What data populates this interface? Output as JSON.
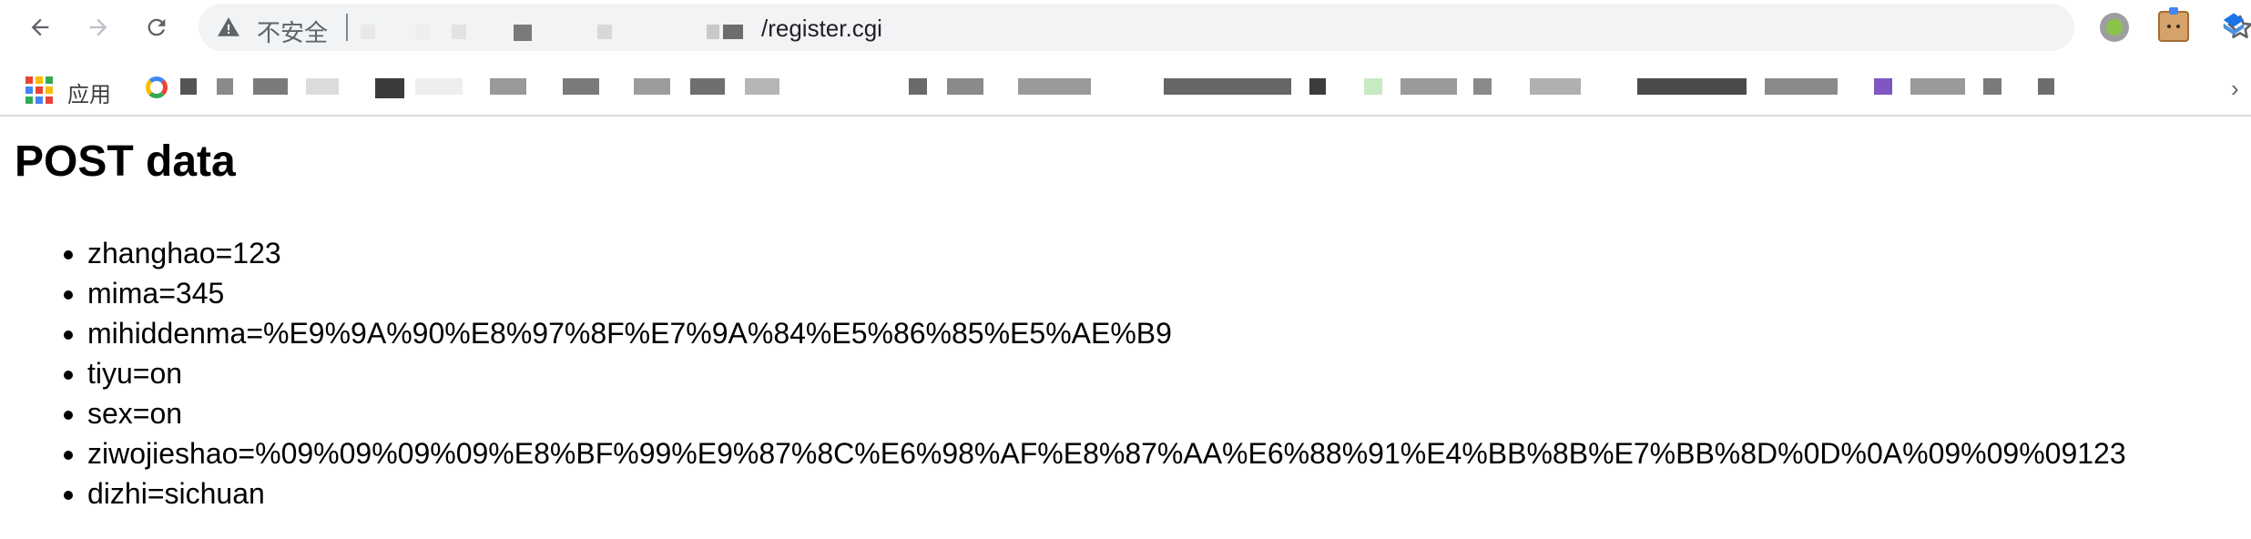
{
  "toolbar": {
    "security_label": "不安全",
    "url_path": "/register.cgi",
    "back_icon": "arrow-left-icon",
    "forward_icon": "arrow-right-icon",
    "reload_icon": "reload-icon",
    "key_icon": "key-icon",
    "star_icon": "star-icon"
  },
  "bookmarks": {
    "apps_label": "应用",
    "overflow_icon": "chevron-right-icon"
  },
  "page": {
    "title": "POST data",
    "items": [
      "zhanghao=123",
      "mima=345",
      "mihiddenma=%E9%9A%90%E8%97%8F%E7%9A%84%E5%86%85%E5%AE%B9",
      "tiyu=on",
      "sex=on",
      "ziwojieshao=%09%09%09%09%E8%BF%99%E9%87%8C%E6%98%AF%E8%87%AA%E6%88%91%E4%BB%8B%E7%BB%8D%0D%0A%09%09%09123",
      "dizhi=sichuan"
    ]
  }
}
